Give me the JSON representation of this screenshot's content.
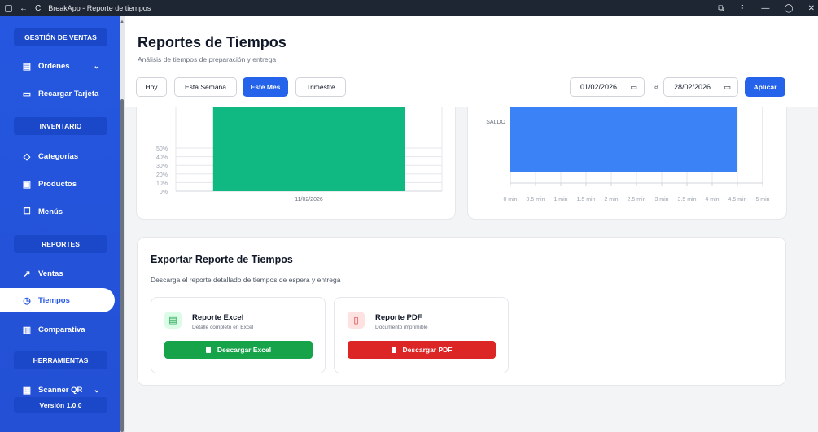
{
  "window": {
    "title": "BreakApp - Reporte de tiempos",
    "back_glyph": "←",
    "reload_glyph": "C",
    "ext_glyph": "⧉",
    "menu_glyph": "⋮",
    "min_glyph": "—",
    "max_glyph": "◯",
    "close_glyph": "✕"
  },
  "sidebar": {
    "sections": [
      {
        "label": "GESTIÓN DE VENTAS"
      },
      {
        "label": "INVENTARIO"
      },
      {
        "label": "REPORTES"
      },
      {
        "label": "HERRAMIENTAS"
      }
    ],
    "items": [
      {
        "label": "Ordenes",
        "icon": "orders-icon",
        "glyph": "▤",
        "chevron": "⌄"
      },
      {
        "label": "Recargar Tarjeta",
        "icon": "card-icon",
        "glyph": "▭"
      },
      {
        "label": "Categorías",
        "icon": "tag-icon",
        "glyph": "◇"
      },
      {
        "label": "Productos",
        "icon": "box-icon",
        "glyph": "▣"
      },
      {
        "label": "Menús",
        "icon": "book-icon",
        "glyph": "⧠"
      },
      {
        "label": "Ventas",
        "icon": "trend-icon",
        "glyph": "↗"
      },
      {
        "label": "Tiempos",
        "icon": "clock-icon",
        "glyph": "◷"
      },
      {
        "label": "Comparativa",
        "icon": "chart-icon",
        "glyph": "▥"
      },
      {
        "label": "Scanner QR",
        "icon": "qr-icon",
        "glyph": "▦",
        "chevron": "⌄"
      }
    ],
    "version": "Versión 1.0.0",
    "scroll_up_glyph": "▲"
  },
  "header": {
    "title": "Reportes de Tiempos",
    "subtitle": "Análisis de tiempos de preparación y entrega",
    "filters": [
      {
        "label": "Hoy",
        "active": false
      },
      {
        "label": "Esta Semana",
        "active": false
      },
      {
        "label": "Este Mes",
        "active": true
      },
      {
        "label": "Trimestre",
        "active": false
      }
    ],
    "date_from": "01/02/2026",
    "date_to": "28/02/2026",
    "date_separator": "a",
    "calendar_glyph": "▭",
    "apply_label": "Aplicar",
    "accent_color": "#2563eb"
  },
  "chart_data": [
    {
      "type": "bar",
      "categories": [
        "11/02/2026"
      ],
      "values": [
        100
      ],
      "unit": "%",
      "y_ticks": [
        "0%",
        "10%",
        "20%",
        "30%",
        "40%",
        "50%"
      ],
      "color": "#10b981",
      "grid": true
    },
    {
      "type": "bar",
      "orientation": "horizontal",
      "categories": [
        "SALDO"
      ],
      "values": [
        4.5
      ],
      "unit": "min",
      "x_ticks": [
        "0 min",
        "0.5 min",
        "1 min",
        "1.5 min",
        "2 min",
        "2.5 min",
        "3 min",
        "3.5 min",
        "4 min",
        "4.5 min",
        "5 min"
      ],
      "xlim": [
        0,
        5
      ],
      "color": "#3b82f6",
      "grid": true
    }
  ],
  "export": {
    "title": "Exportar Reporte de Tiempos",
    "description": "Descarga el reporte detallado de tiempos de espera y entrega",
    "excel": {
      "title": "Reporte Excel",
      "subtitle": "Detalle completo en Excel",
      "button": "Descargar Excel",
      "color": "#16a34a",
      "icon_glyph": "▤"
    },
    "pdf": {
      "title": "Reporte PDF",
      "subtitle": "Documento imprimible",
      "button": "Descargar PDF",
      "color": "#dc2626",
      "icon_glyph": "▯"
    }
  }
}
